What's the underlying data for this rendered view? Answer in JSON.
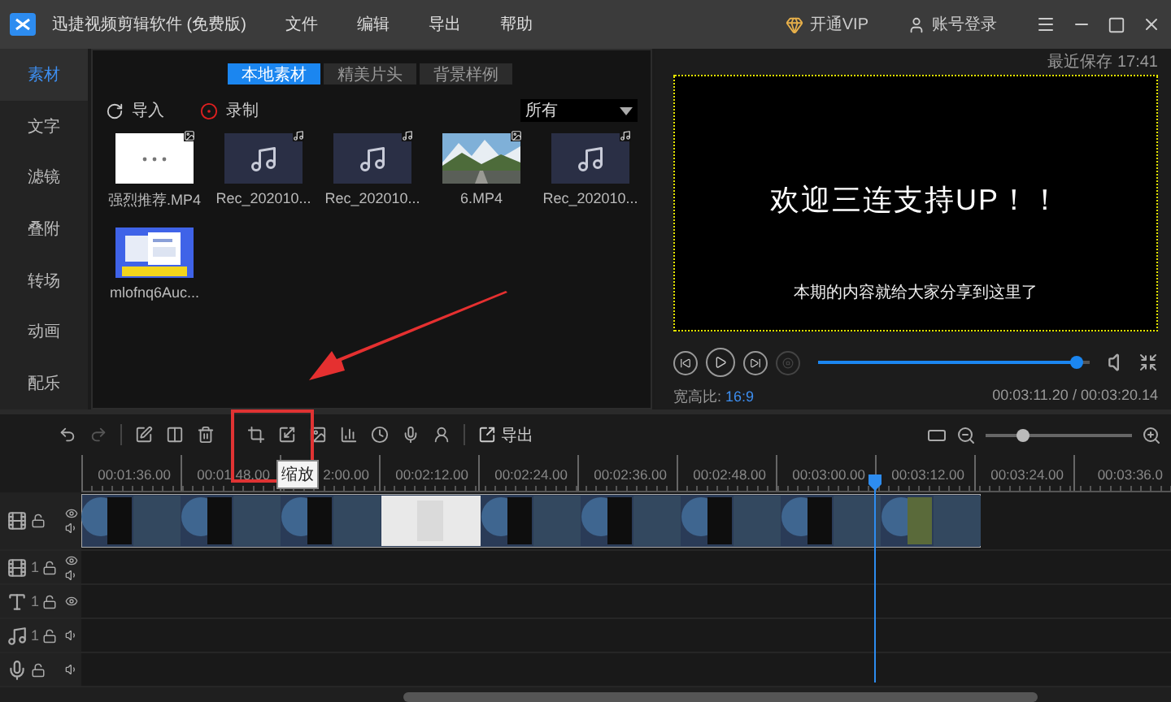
{
  "window": {
    "title": "迅捷视频剪辑软件 (免费版)",
    "menus": [
      "文件",
      "编辑",
      "导出",
      "帮助"
    ],
    "vip": "开通VIP",
    "account": "账号登录"
  },
  "sidebar": {
    "items": [
      {
        "label": "素材",
        "selected": true
      },
      {
        "label": "文字",
        "selected": false
      },
      {
        "label": "滤镜",
        "selected": false
      },
      {
        "label": "叠附",
        "selected": false
      },
      {
        "label": "转场",
        "selected": false
      },
      {
        "label": "动画",
        "selected": false
      },
      {
        "label": "配乐",
        "selected": false
      }
    ]
  },
  "media": {
    "tabs": [
      {
        "label": "本地素材",
        "selected": true
      },
      {
        "label": "精美片头",
        "selected": false
      },
      {
        "label": "背景样例",
        "selected": false
      }
    ],
    "import": "导入",
    "record": "录制",
    "filter": "所有",
    "items": [
      {
        "name": "强烈推荐.MP4",
        "kind": "blank"
      },
      {
        "name": "Rec_202010...",
        "kind": "audio"
      },
      {
        "name": "Rec_202010...",
        "kind": "audio"
      },
      {
        "name": "6.MP4",
        "kind": "landscape"
      },
      {
        "name": "Rec_202010...",
        "kind": "audio"
      },
      {
        "name": "mlofnq6Auc...",
        "kind": "document"
      }
    ]
  },
  "preview": {
    "saved": "最近保存 17:41",
    "headline": "欢迎三连支持UP！！",
    "subtitle": "本期的内容就给大家分享到这里了",
    "level": 0.95,
    "aspect_label": "宽高比:",
    "aspect": "16:9",
    "time": "00:03:11.20 / 00:03:20.14"
  },
  "timeline": {
    "export": "导出",
    "tooltip": "缩放",
    "zoom": {
      "level": 0.25
    },
    "ruler": [
      "00:01:36.00",
      "00:01:48.00",
      "2:00.00",
      "00:02:12.00",
      "00:02:24.00",
      "00:02:36.00",
      "00:02:48.00",
      "00:03:00.00",
      "00:03:12.00",
      "00:03:24.00",
      "00:03:36.0"
    ],
    "tracks": [
      {
        "kind": "main"
      },
      {
        "kind": "video",
        "number": "1"
      },
      {
        "kind": "text",
        "number": "1"
      },
      {
        "kind": "music",
        "number": "1"
      },
      {
        "kind": "voice"
      }
    ]
  }
}
